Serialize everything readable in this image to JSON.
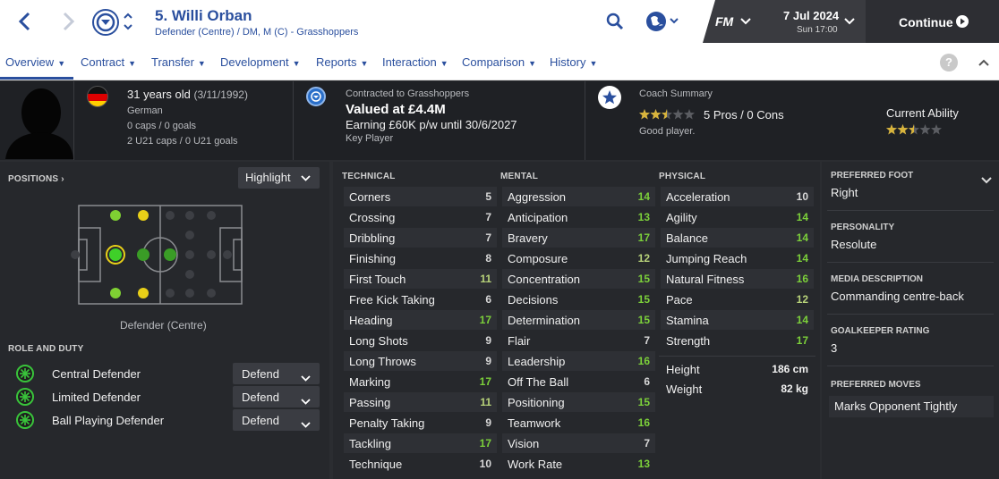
{
  "header": {
    "title": "5. Willi Orban",
    "subtitle": "Defender (Centre) / DM, M (C) - Grasshoppers",
    "fm_label": "FM",
    "date": "7 Jul 2024",
    "time": "Sun 17:00",
    "continue_label": "Continue"
  },
  "nav": {
    "tabs": [
      "Overview",
      "Contract",
      "Transfer",
      "Development",
      "Reports",
      "Interaction",
      "Comparison",
      "History"
    ],
    "help": "?"
  },
  "summary": {
    "age": "31 years old",
    "dob": "(3/11/1992)",
    "nationality": "German",
    "caps": "0 caps / 0 goals",
    "u21": "2 U21 caps / 0 U21 goals",
    "contract_label": "Contracted to Grasshoppers",
    "value": "Valued at £4.4M",
    "earning": "Earning £60K p/w until 30/6/2027",
    "squad_status": "Key Player",
    "coach_title": "Coach Summary",
    "pros_cons": "5 Pros / 0 Cons",
    "coach_note": "Good player.",
    "coach_stars": 2.5,
    "current_ability_label": "Current Ability",
    "current_ability_stars": 2.5
  },
  "positions": {
    "heading": "POSITIONS",
    "highlight_label": "Highlight",
    "position_name": "Defender (Centre)"
  },
  "roles": {
    "heading": "ROLE AND DUTY",
    "items": [
      {
        "name": "Central Defender",
        "duty": "Defend"
      },
      {
        "name": "Limited Defender",
        "duty": "Defend"
      },
      {
        "name": "Ball Playing Defender",
        "duty": "Defend"
      }
    ]
  },
  "technical": {
    "heading": "TECHNICAL",
    "items": [
      {
        "name": "Corners",
        "value": "5"
      },
      {
        "name": "Crossing",
        "value": "7"
      },
      {
        "name": "Dribbling",
        "value": "7"
      },
      {
        "name": "Finishing",
        "value": "8"
      },
      {
        "name": "First Touch",
        "value": "11"
      },
      {
        "name": "Free Kick Taking",
        "value": "6"
      },
      {
        "name": "Heading",
        "value": "17"
      },
      {
        "name": "Long Shots",
        "value": "9"
      },
      {
        "name": "Long Throws",
        "value": "9"
      },
      {
        "name": "Marking",
        "value": "17"
      },
      {
        "name": "Passing",
        "value": "11"
      },
      {
        "name": "Penalty Taking",
        "value": "9"
      },
      {
        "name": "Tackling",
        "value": "17"
      },
      {
        "name": "Technique",
        "value": "10"
      }
    ]
  },
  "mental": {
    "heading": "MENTAL",
    "items": [
      {
        "name": "Aggression",
        "value": "14"
      },
      {
        "name": "Anticipation",
        "value": "13"
      },
      {
        "name": "Bravery",
        "value": "17"
      },
      {
        "name": "Composure",
        "value": "12"
      },
      {
        "name": "Concentration",
        "value": "15"
      },
      {
        "name": "Decisions",
        "value": "15"
      },
      {
        "name": "Determination",
        "value": "15"
      },
      {
        "name": "Flair",
        "value": "7"
      },
      {
        "name": "Leadership",
        "value": "16"
      },
      {
        "name": "Off The Ball",
        "value": "6"
      },
      {
        "name": "Positioning",
        "value": "15"
      },
      {
        "name": "Teamwork",
        "value": "16"
      },
      {
        "name": "Vision",
        "value": "7"
      },
      {
        "name": "Work Rate",
        "value": "13"
      }
    ]
  },
  "physical": {
    "heading": "PHYSICAL",
    "items": [
      {
        "name": "Acceleration",
        "value": "10"
      },
      {
        "name": "Agility",
        "value": "14"
      },
      {
        "name": "Balance",
        "value": "14"
      },
      {
        "name": "Jumping Reach",
        "value": "14"
      },
      {
        "name": "Natural Fitness",
        "value": "16"
      },
      {
        "name": "Pace",
        "value": "12"
      },
      {
        "name": "Stamina",
        "value": "14"
      },
      {
        "name": "Strength",
        "value": "17"
      }
    ],
    "height_label": "Height",
    "height": "186 cm",
    "weight_label": "Weight",
    "weight": "82 kg"
  },
  "details": {
    "foot_label": "PREFERRED FOOT",
    "foot": "Right",
    "personality_label": "PERSONALITY",
    "personality": "Resolute",
    "media_label": "MEDIA DESCRIPTION",
    "media": "Commanding centre-back",
    "gk_label": "GOALKEEPER RATING",
    "gk": "3",
    "moves_label": "PREFERRED MOVES",
    "moves": "Marks Opponent Tightly"
  },
  "colors": {
    "accent": "#2a4f9e",
    "attr_high": "#7cd03a",
    "attr_mid": "#b8d37a",
    "attr_low": "#d8d8d8",
    "star": "#d8b43c"
  }
}
